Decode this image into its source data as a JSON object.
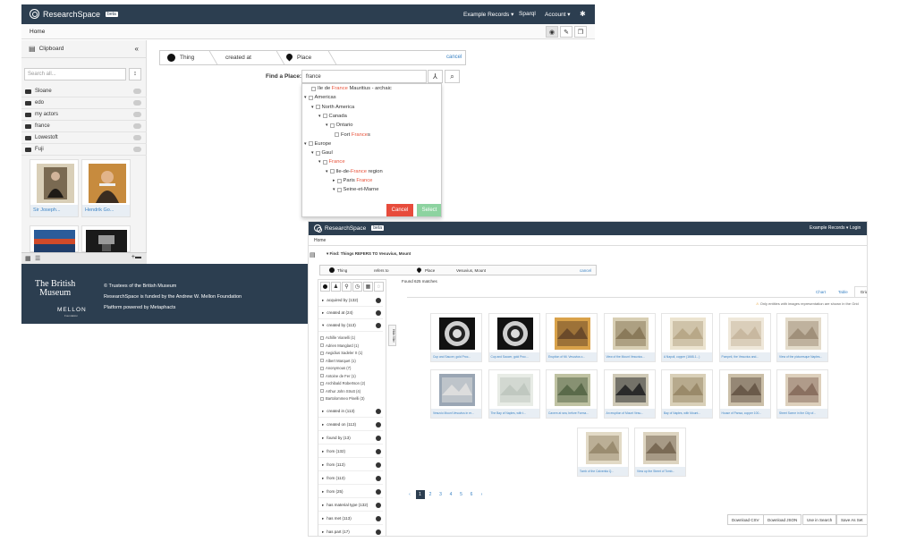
{
  "app": {
    "name": "ResearchSpace",
    "badge": "beta"
  },
  "window1": {
    "nav": {
      "example_records": "Example Records ▾",
      "sparql": "Sparql",
      "account": "Account ▾",
      "settings_icon": "gear-icon"
    },
    "breadcrumb": "Home",
    "clipboard": {
      "title": "Clipboard",
      "collapse": "«",
      "search_placeholder": "Search all...",
      "sort_icon": "↕",
      "folders": [
        "Sloane",
        "edo",
        "my actors",
        "france",
        "Lowestoft",
        "Fuji"
      ],
      "items": [
        {
          "label": "Sir Joseph..."
        },
        {
          "label": "Hendrik Go..."
        }
      ]
    },
    "query": {
      "segments": [
        "Thing",
        "created at",
        "Place"
      ],
      "cancel": "cancel",
      "find_label": "Find a Place:",
      "find_value": "france"
    },
    "tree": {
      "nodes": [
        {
          "pre": "Ile de ",
          "hl": "France",
          "post": " Mauritius - archaic"
        },
        {
          "pre": "Americas",
          "hl": "",
          "post": ""
        },
        {
          "pre": "North America",
          "hl": "",
          "post": ""
        },
        {
          "pre": "Canada",
          "hl": "",
          "post": ""
        },
        {
          "pre": "Ontario",
          "hl": "",
          "post": ""
        },
        {
          "pre": "Fort ",
          "hl": "France",
          "post": "s"
        },
        {
          "pre": "Europe",
          "hl": "",
          "post": ""
        },
        {
          "pre": "Gaul",
          "hl": "",
          "post": ""
        },
        {
          "pre": "",
          "hl": "France",
          "post": ""
        },
        {
          "pre": "Ile-de-",
          "hl": "France",
          "post": " region"
        },
        {
          "pre": "Paris ",
          "hl": "France",
          "post": ""
        },
        {
          "pre": "Seine-et-Marne",
          "hl": "",
          "post": ""
        }
      ],
      "cancel_button": "Cancel",
      "select_button": "Select"
    },
    "footer": {
      "logo_line1": "The British",
      "logo_line2": "Museum",
      "mellon": "MELLON",
      "mellon_sub": "Foundation",
      "line1": "© Trustees of the British Museum",
      "line2": "ResearchSpace is funded by the Andrew W. Mellon Foundation",
      "line3": "Platform powered by Metaphacts"
    }
  },
  "window2": {
    "nav": {
      "example_records": "Example Records ▾",
      "login": "Login"
    },
    "breadcrumb": "Home",
    "find_line": "Find: Things REFERS TO Vesuvius, Mount",
    "segments": [
      "Thing",
      "refers to",
      "Place",
      "Vesuvius, Mount"
    ],
    "cancel": "cancel",
    "found": "Found 625 matches",
    "tabs": [
      "Chart",
      "Table",
      "Grid"
    ],
    "notice": "Only entities with images representation are shown in the Grid",
    "facets": [
      {
        "label": "acquired by (132)"
      },
      {
        "label": "created at (24)"
      },
      {
        "label": "created by (113)"
      }
    ],
    "facet_values": [
      "Achille Vianelli (1)",
      "Adrien Manglard (1)",
      "Aegidius Sadeler II (1)",
      "Albert Marquet (1)",
      "Anonymous (7)",
      "Antoine de Fer (1)",
      "Archibald Robertson (2)",
      "Arthur John Strutt (4)",
      "Bartolommeo Pinelli (3)"
    ],
    "facets_lower": [
      {
        "label": "created in (113)"
      },
      {
        "label": "created on (113)"
      },
      {
        "label": "found by (13)"
      },
      {
        "label": "from (132)"
      },
      {
        "label": "from (113)"
      },
      {
        "label": "from (113)"
      },
      {
        "label": "from (25)"
      },
      {
        "label": "has material type (132)"
      },
      {
        "label": "has met (113)"
      },
      {
        "label": "has part (17)"
      }
    ],
    "hide_filter": "Hide filter",
    "grid": [
      {
        "label": "Cup and Saucer, gold Proc..."
      },
      {
        "label": "Cup and Saucer, gold Proc..."
      },
      {
        "label": "Eruption of Mt. Vesuvius o..."
      },
      {
        "label": "View of the Mount Vesuvius..."
      },
      {
        "label": "A Napoli, copper (1668-1...)"
      },
      {
        "label": "Pompeii, the Vesuvius and..."
      },
      {
        "label": "View of the picturesque Naples..."
      },
      {
        "label": "Vesuvio Mount Vesuvius in er..."
      },
      {
        "label": "The Bay of Naples, with t..."
      },
      {
        "label": "Cavern at sea, before Forma..."
      },
      {
        "label": "An eruption of Mount Vesu..."
      },
      {
        "label": "Bay of Naples, with Mount..."
      },
      {
        "label": "House of Pansa, copper 100..."
      },
      {
        "label": "Street Scene in the City of..."
      },
      {
        "label": "Tomb of the Calventia Q..."
      },
      {
        "label": "View up the Street of Tomb..."
      }
    ],
    "pages": [
      "‹",
      "1",
      "2",
      "3",
      "4",
      "5",
      "6",
      "›"
    ],
    "buttons": [
      "Download CSV",
      "Download JSON",
      "Use in Search",
      "Save As Set"
    ]
  }
}
